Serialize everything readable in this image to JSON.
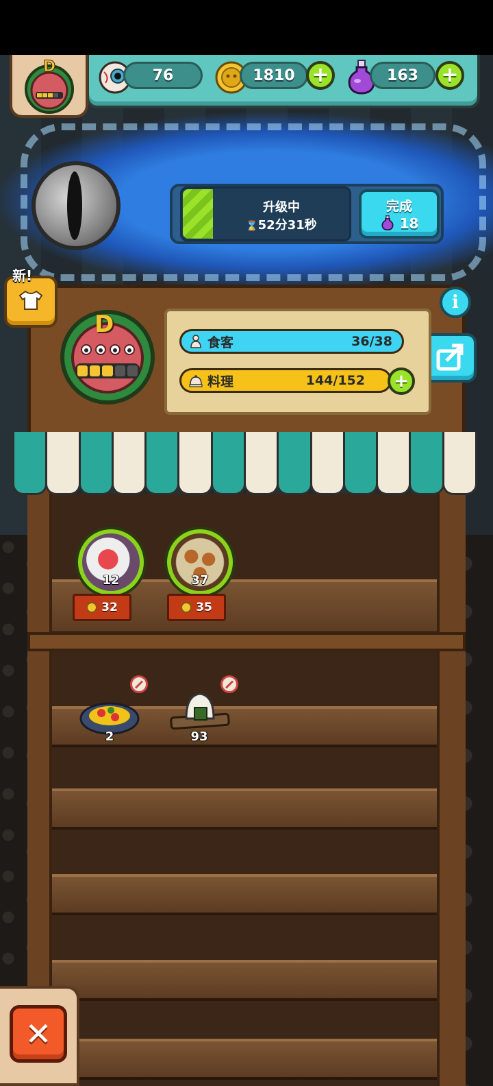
{
  "currencies": {
    "eyeballs": "76",
    "coins": "1810",
    "potions": "163"
  },
  "upgrade": {
    "status_label": "升级中",
    "time_remaining": "52分31秒",
    "progress": 0.18,
    "finish_label": "完成",
    "finish_cost": "18"
  },
  "new_badge": "新!",
  "shop": {
    "rank_letter": "D",
    "rank_level": 3,
    "rank_max": 5,
    "diners_label": "食客",
    "diners_value": "36/38",
    "diners_fraction": 0.947,
    "cooking_label": "料理",
    "cooking_value": "144/152",
    "cooking_fraction": 0.947
  },
  "displayed_dishes": [
    {
      "name": "dish-crab-rice",
      "count": "12",
      "price": "32"
    },
    {
      "name": "dish-roasted-buns",
      "count": "37",
      "price": "35"
    }
  ],
  "stock_dishes": [
    {
      "name": "dish-mixed-salad",
      "count": "2"
    },
    {
      "name": "dish-rice-ball",
      "count": "93"
    }
  ],
  "colors": {
    "accent_green": "#9be22a",
    "cyan_button": "#3ad9f0",
    "gold": "#f6c21a"
  }
}
